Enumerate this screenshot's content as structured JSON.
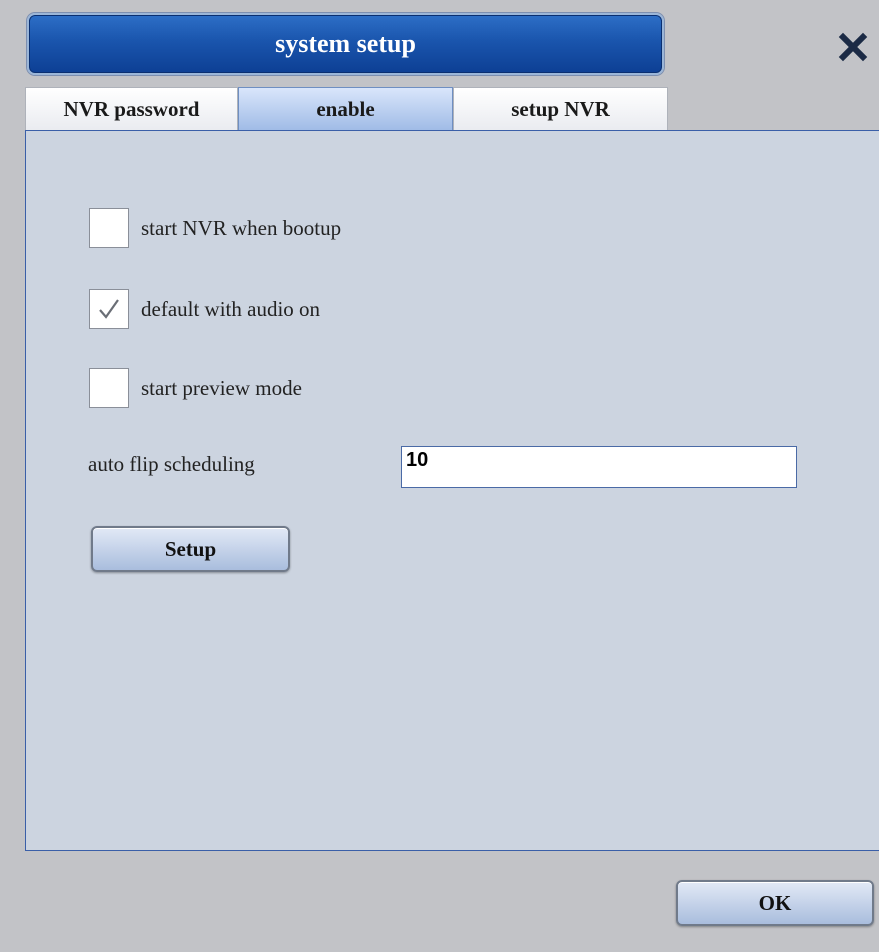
{
  "window": {
    "title": "system setup",
    "close_icon": "close-icon"
  },
  "tabs": [
    {
      "label": "NVR password",
      "active": false
    },
    {
      "label": "enable",
      "active": true
    },
    {
      "label": "setup NVR",
      "active": false
    }
  ],
  "options": [
    {
      "label": "start NVR when bootup",
      "checked": false
    },
    {
      "label": "default with audio on",
      "checked": true
    },
    {
      "label": "start preview mode",
      "checked": false
    }
  ],
  "auto_flip": {
    "label": "auto flip scheduling",
    "value": "10"
  },
  "buttons": {
    "setup": "Setup",
    "ok": "OK"
  },
  "colors": {
    "title_bar": "#1a55ad",
    "panel_bg": "#ccd4e0",
    "active_tab": "#9fbbe6",
    "window_bg": "#c2c3c7"
  }
}
